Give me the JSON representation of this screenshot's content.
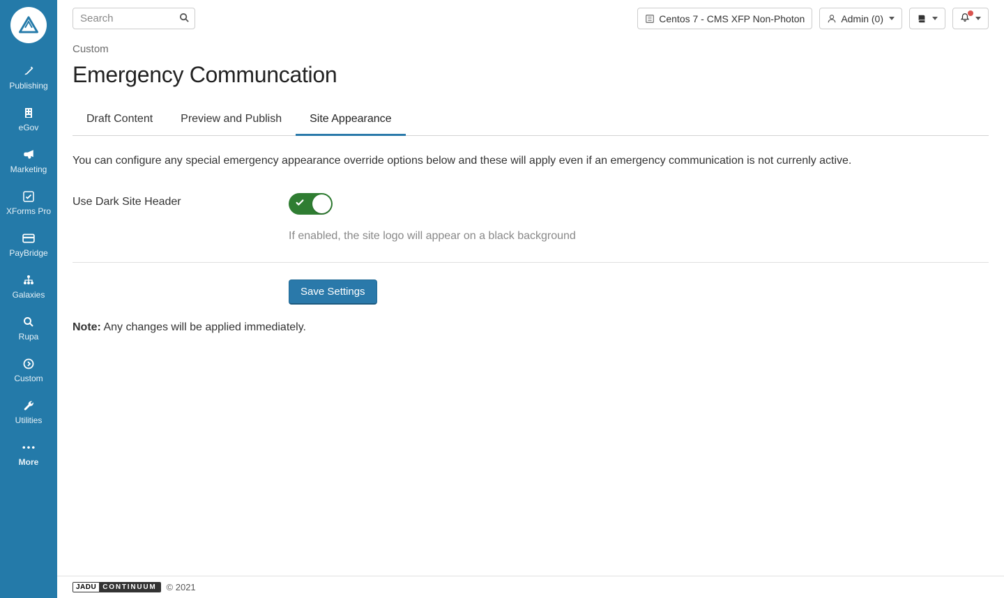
{
  "sidebar": {
    "items": [
      {
        "label": "Publishing"
      },
      {
        "label": "eGov"
      },
      {
        "label": "Marketing"
      },
      {
        "label": "XForms Pro"
      },
      {
        "label": "PayBridge"
      },
      {
        "label": "Galaxies"
      },
      {
        "label": "Rupa"
      },
      {
        "label": "Custom"
      },
      {
        "label": "Utilities"
      },
      {
        "label": "More"
      }
    ]
  },
  "topbar": {
    "search_placeholder": "Search",
    "env_label": "Centos 7 - CMS XFP Non-Photon",
    "user_label": "Admin (0)"
  },
  "page": {
    "breadcrumb": "Custom",
    "title": "Emergency Communcation",
    "tabs": [
      {
        "label": "Draft Content"
      },
      {
        "label": "Preview and Publish"
      },
      {
        "label": "Site Appearance"
      }
    ],
    "active_tab_index": 2,
    "description": "You can configure any special emergency appearance override options below and these will apply even if an emergency communication is not currenly active.",
    "toggle_label": "Use Dark Site Header",
    "toggle_on": true,
    "toggle_help": "If enabled, the site logo will appear on a black background",
    "save_label": "Save Settings",
    "note_label": "Note:",
    "note_text": " Any changes will be applied immediately."
  },
  "footer": {
    "brand1": "JADU",
    "brand2": "CONTINUUM",
    "copyright": "© 2021"
  }
}
